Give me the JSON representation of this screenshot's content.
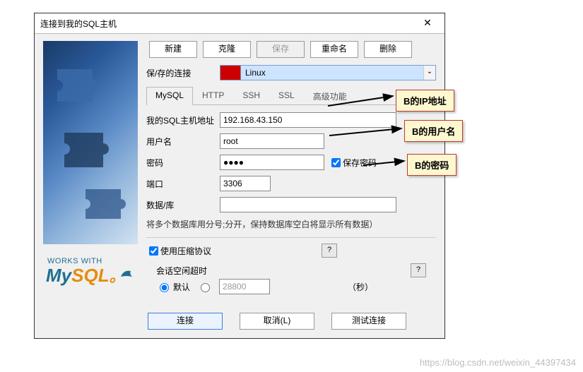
{
  "title": "连接到我的SQL主机",
  "toolbar": {
    "new": "新建",
    "clone": "克隆",
    "save": "保存",
    "rename": "重命名",
    "delete": "删除"
  },
  "saved": {
    "label": "保/存的连接",
    "value": "Linux"
  },
  "tabs": {
    "mysql": "MySQL",
    "http": "HTTP",
    "ssh": "SSH",
    "ssl": "SSL",
    "advanced": "高级功能"
  },
  "form": {
    "host_label": "我的SQL主机地址",
    "host_value": "192.168.43.150",
    "user_label": "用户名",
    "user_value": "root",
    "pass_label": "密码",
    "pass_value": "●●●●",
    "save_pass_label": "保存密码",
    "port_label": "端口",
    "port_value": "3306",
    "db_label": "数据/库",
    "db_value": "",
    "db_hint": "将多个数据库用分号;分开，保持数据库空白将显示所有数据）",
    "compress_label": "使用压缩协议",
    "idle_label": "会话空闲超时",
    "idle_default": "默认",
    "idle_custom": "28800",
    "idle_unit": "（秒）"
  },
  "footer": {
    "connect": "连接",
    "cancel": "取消(L)",
    "test": "测试连接"
  },
  "logo": {
    "works": "WORKS WITH",
    "my": "My",
    "sql": "SQL",
    "dot": "。"
  },
  "callouts": {
    "ip": "B的IP地址",
    "user": "B的用户名",
    "pass": "B的密码"
  },
  "watermark": "https://blog.csdn.net/weixin_44397434"
}
